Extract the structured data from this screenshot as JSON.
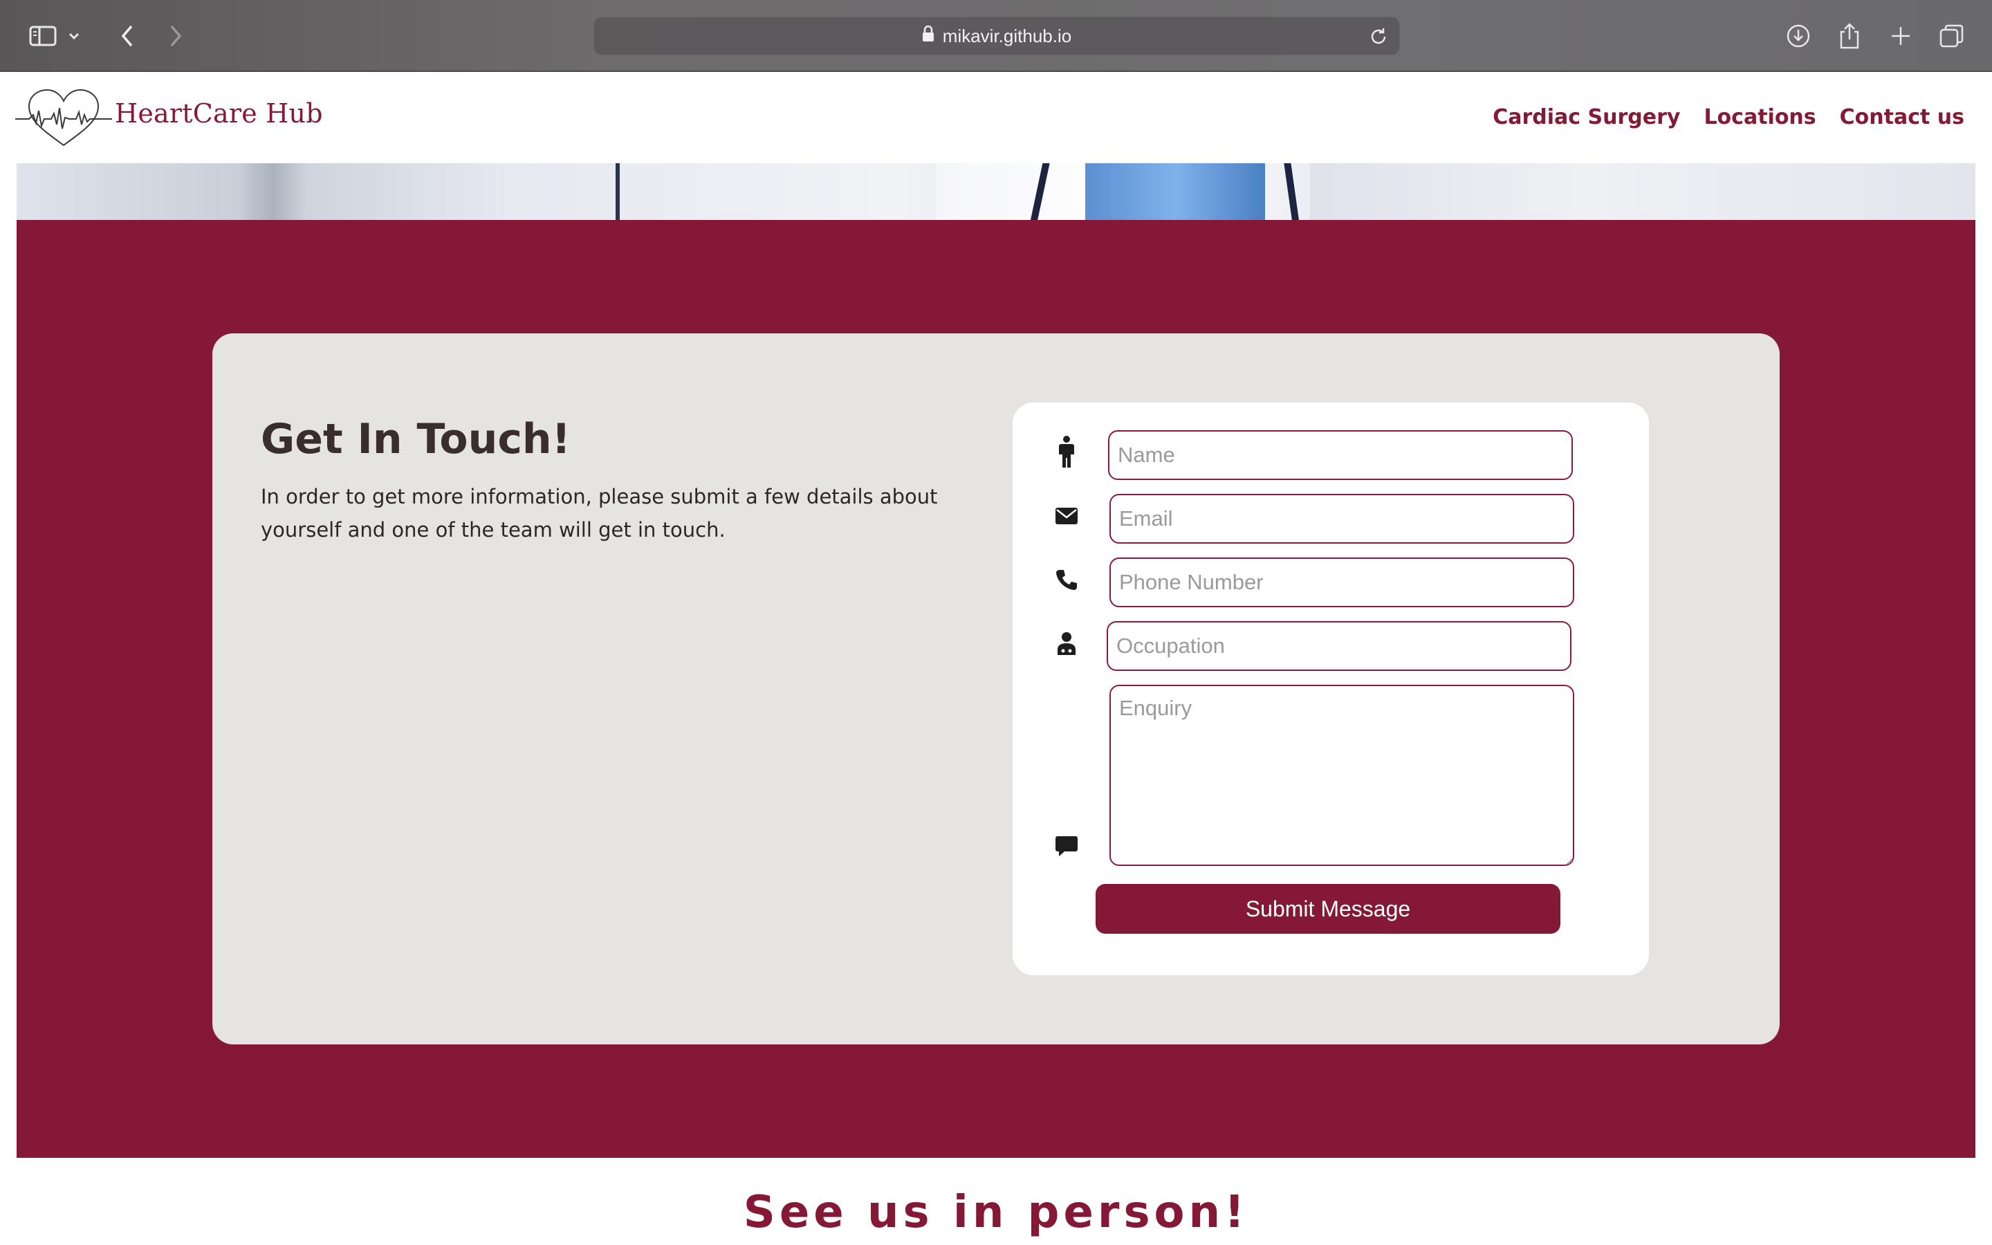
{
  "browser": {
    "url": "mikavir.github.io",
    "icons": [
      "sidebar-icon",
      "chevron-down-icon",
      "back-icon",
      "forward-icon",
      "lock-icon",
      "reload-icon",
      "download-icon",
      "share-icon",
      "new-tab-icon",
      "tabs-overview-icon"
    ]
  },
  "header": {
    "brand": "HeartCare Hub",
    "nav": [
      "Cardiac Surgery",
      "Locations",
      "Contact us"
    ]
  },
  "contact": {
    "title": "Get In Touch!",
    "text": "In order to get more information, please submit a few details about yourself and one of the team will get in touch.",
    "fields": {
      "name_placeholder": "Name",
      "email_placeholder": "Email",
      "phone_placeholder": "Phone Number",
      "occupation_placeholder": "Occupation",
      "enquiry_placeholder": "Enquiry"
    },
    "submit_label": "Submit Message"
  },
  "footer": {
    "heading": "See us in person!"
  },
  "colors": {
    "brand": "#841836",
    "card": "#e6e4e3",
    "heading": "#3a2d2d"
  }
}
